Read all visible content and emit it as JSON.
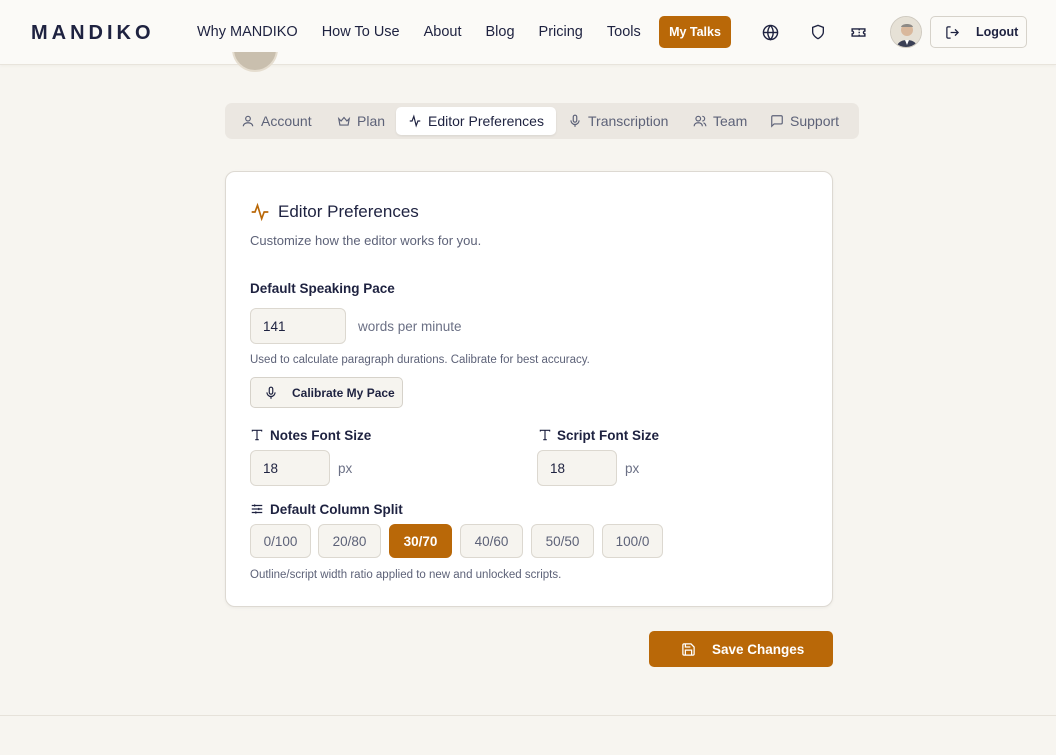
{
  "header": {
    "logo": "MANDIKO",
    "nav": [
      "Why MANDIKO",
      "How To Use",
      "About",
      "Blog",
      "Pricing",
      "Tools"
    ],
    "my_talks": "My Talks",
    "logout": "Logout",
    "icons": [
      "globe-icon",
      "shield-icon",
      "ticket-icon"
    ]
  },
  "tabs": [
    {
      "label": "Account",
      "icon": "user-icon"
    },
    {
      "label": "Plan",
      "icon": "crown-icon"
    },
    {
      "label": "Editor Preferences",
      "icon": "activity-icon",
      "active": true
    },
    {
      "label": "Transcription",
      "icon": "mic-icon"
    },
    {
      "label": "Team",
      "icon": "users-icon"
    },
    {
      "label": "Support",
      "icon": "message-icon"
    }
  ],
  "editor": {
    "title": "Editor Preferences",
    "subtitle": "Customize how the editor works for you.",
    "pace_label": "Default Speaking Pace",
    "pace_value": "141",
    "pace_unit": "words per minute",
    "pace_hint": "Used to calculate paragraph durations. Calibrate for best accuracy.",
    "calibrate_label": "Calibrate My Pace",
    "notes_font_label": "Notes Font Size",
    "notes_font_value": "18",
    "script_font_label": "Script Font Size",
    "script_font_value": "18",
    "font_unit": "px",
    "split_label": "Default Column Split",
    "splits": [
      "0/100",
      "20/80",
      "30/70",
      "40/60",
      "50/50",
      "100/0"
    ],
    "split_selected": "30/70",
    "split_hint": "Outline/script width ratio applied to new and unlocked scripts."
  },
  "save_label": "Save Changes",
  "colors": {
    "accent": "#b96808",
    "text": "#1e2240",
    "background": "#f7f5f0"
  }
}
